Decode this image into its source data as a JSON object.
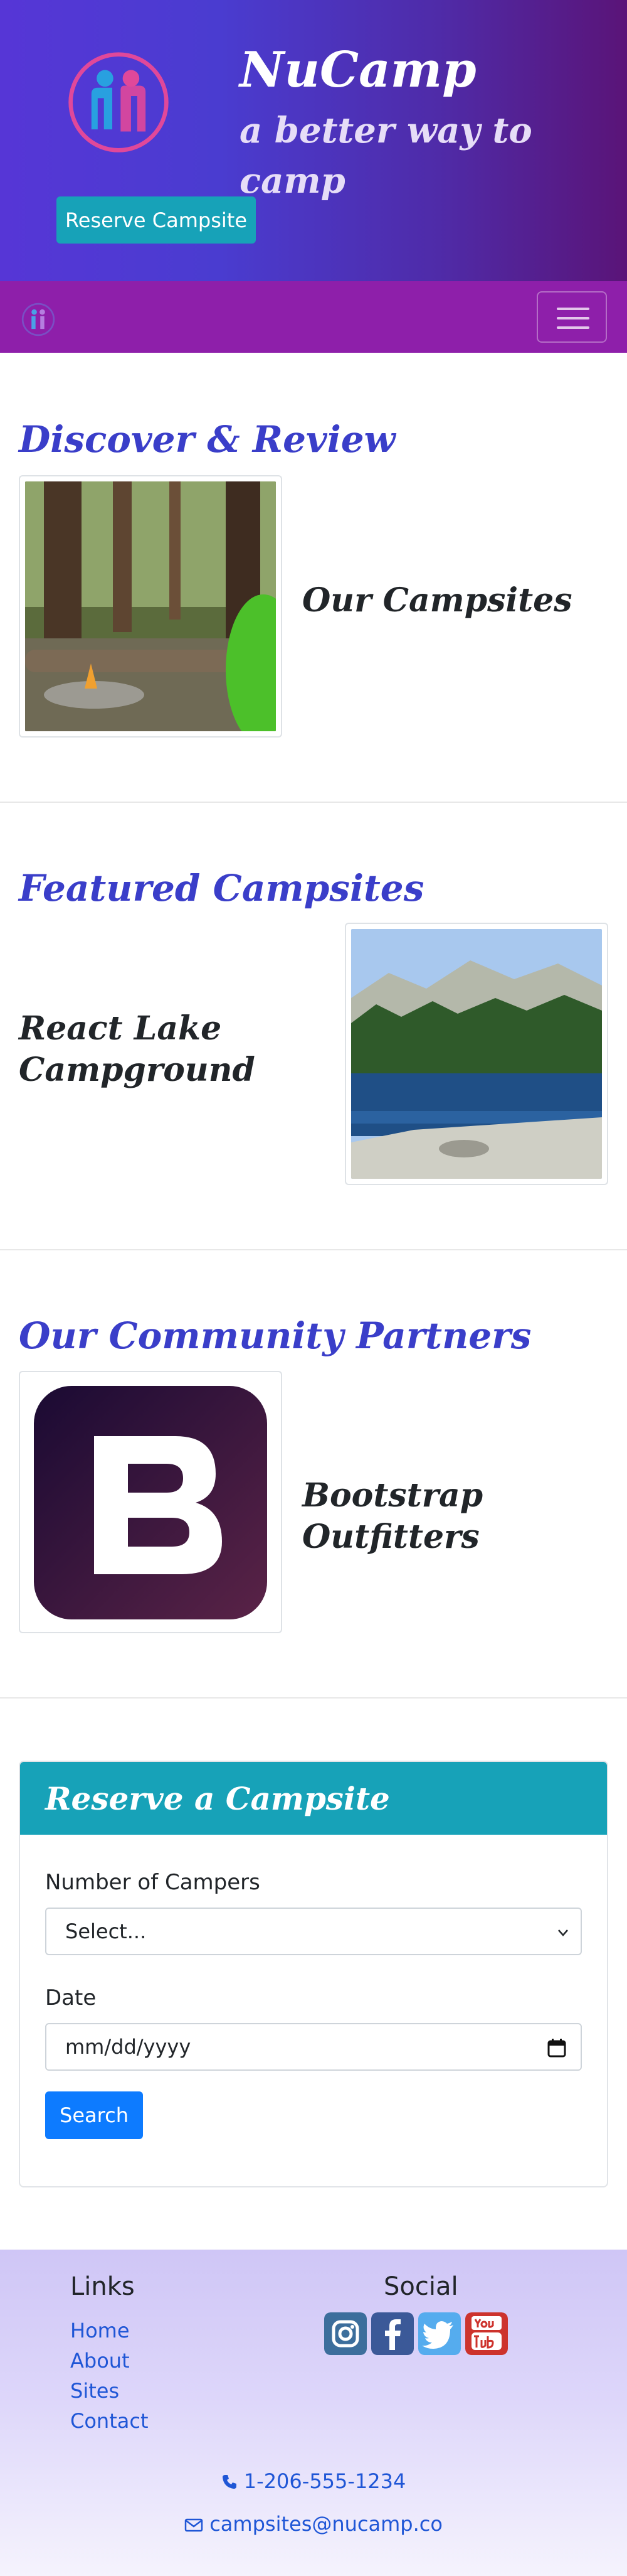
{
  "header": {
    "brand": "NuCamp",
    "tagline": "a better way to camp",
    "reserve_button": "Reserve Campsite"
  },
  "navbar": {
    "logo_icon": "nucamp-logo-icon",
    "toggler_icon": "hamburger-menu-icon"
  },
  "discover": {
    "title": "Discover & Review",
    "item_heading": "Our Campsites"
  },
  "featured": {
    "title": "Featured Campsites",
    "item_heading_line1": "React Lake",
    "item_heading_line2": "Campground"
  },
  "partners": {
    "title": "Our Community Partners",
    "item_heading": "Bootstrap Outfitters"
  },
  "reserve_form": {
    "title": "Reserve a Campsite",
    "campers_label": "Number of Campers",
    "campers_selected": "Select...",
    "date_label": "Date",
    "date_placeholder": "mm/dd/yyyy",
    "search_button": "Search"
  },
  "footer": {
    "links_heading": "Links",
    "links": [
      "Home",
      "About",
      "Sites",
      "Contact"
    ],
    "social_heading": "Social",
    "social_icons": [
      "instagram-icon",
      "facebook-icon",
      "twitter-icon",
      "youtube-icon"
    ],
    "phone": "1-206-555-1234",
    "email": "campsites@nucamp.co"
  },
  "colors": {
    "accent_teal": "#17a2b8",
    "navbar_purple": "#8e1faa",
    "heading_blue": "#3a3ec9",
    "link_blue": "#1f56d6",
    "primary_button": "#0d7bff"
  }
}
